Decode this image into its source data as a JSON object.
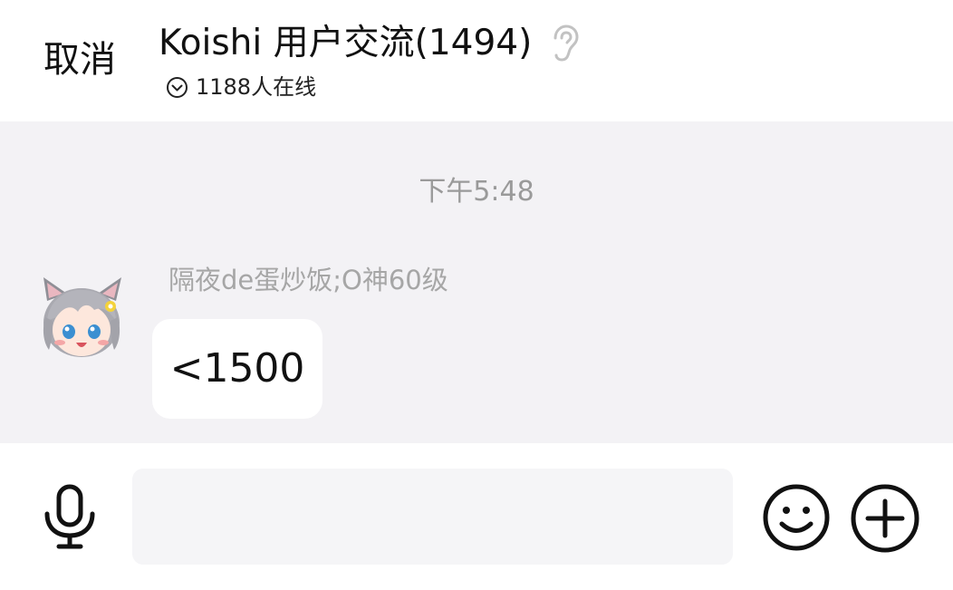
{
  "header": {
    "cancel_label": "取消",
    "title": "Koishi 用户交流(1494)",
    "online_count": "1188人在线"
  },
  "chat": {
    "timestamp": "下午5:48",
    "messages": [
      {
        "sender": "隔夜de蛋炒饭;O神60级",
        "text": "<1500"
      }
    ]
  },
  "input_bar": {
    "placeholder": "",
    "value": ""
  },
  "icons": {
    "ear": "ear-icon",
    "chevron": "chevron-down-circle-icon",
    "mic": "microphone-icon",
    "emoji": "smiley-icon",
    "plus": "plus-circle-icon"
  }
}
